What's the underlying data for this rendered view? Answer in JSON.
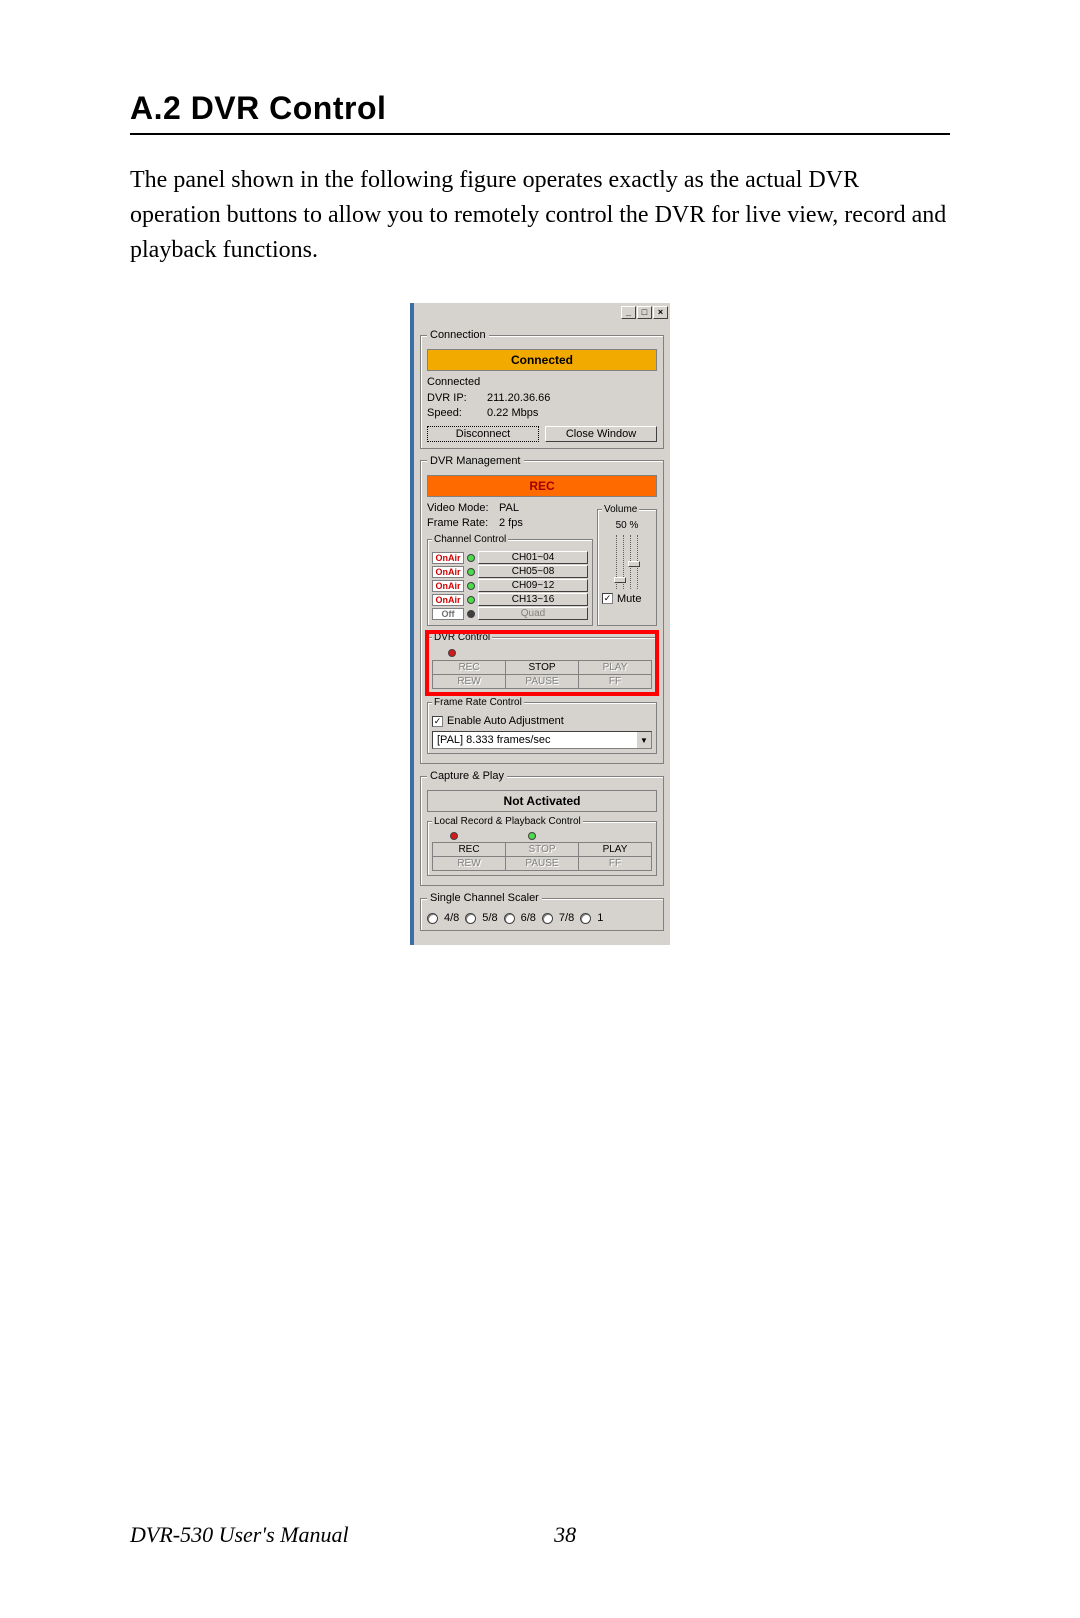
{
  "heading": "A.2  DVR Control",
  "paragraph": "The panel shown in the following figure operates exactly as the actual DVR operation buttons to allow you to remotely control the DVR for live view, record and playback functions.",
  "footer_manual": "DVR-530 User's Manual",
  "footer_page": "38",
  "titlebar": {
    "minimize": "_",
    "restore": "□",
    "close": "×"
  },
  "connection": {
    "legend": "Connection",
    "banner": "Connected",
    "status": "Connected",
    "ip_label": "DVR IP:",
    "ip": "211.20.36.66",
    "speed_label": "Speed:",
    "speed": "0.22 Mbps",
    "disconnect": "Disconnect",
    "close_window": "Close Window"
  },
  "management": {
    "legend": "DVR Management",
    "banner": "REC",
    "video_mode_label": "Video Mode:",
    "video_mode": "PAL",
    "frame_rate_label": "Frame Rate:",
    "frame_rate": "2 fps",
    "volume_legend": "Volume",
    "volume_value": "50 %",
    "mute": "Mute",
    "channel_legend": "Channel Control",
    "channels": [
      {
        "status": "OnAir",
        "range": "CH01~04"
      },
      {
        "status": "OnAir",
        "range": "CH05~08"
      },
      {
        "status": "OnAir",
        "range": "CH09~12"
      },
      {
        "status": "OnAir",
        "range": "CH13~16"
      }
    ],
    "off_label": "Off",
    "quad": "Quad"
  },
  "dvr_control": {
    "legend": "DVR Control",
    "buttons": [
      "REC",
      "STOP",
      "PLAY",
      "REW",
      "PAUSE",
      "FF"
    ]
  },
  "frame_rate_control": {
    "legend": "Frame Rate Control",
    "checkbox": "Enable Auto Adjustment",
    "dropdown": "[PAL]  8.333 frames/sec"
  },
  "capture_play": {
    "legend": "Capture & Play",
    "banner": "Not Activated",
    "inner_legend": "Local Record & Playback Control",
    "buttons": [
      "REC",
      "STOP",
      "PLAY",
      "REW",
      "PAUSE",
      "FF"
    ]
  },
  "scaler": {
    "legend": "Single Channel Scaler",
    "options": [
      "4/8",
      "5/8",
      "6/8",
      "7/8",
      "1"
    ]
  }
}
